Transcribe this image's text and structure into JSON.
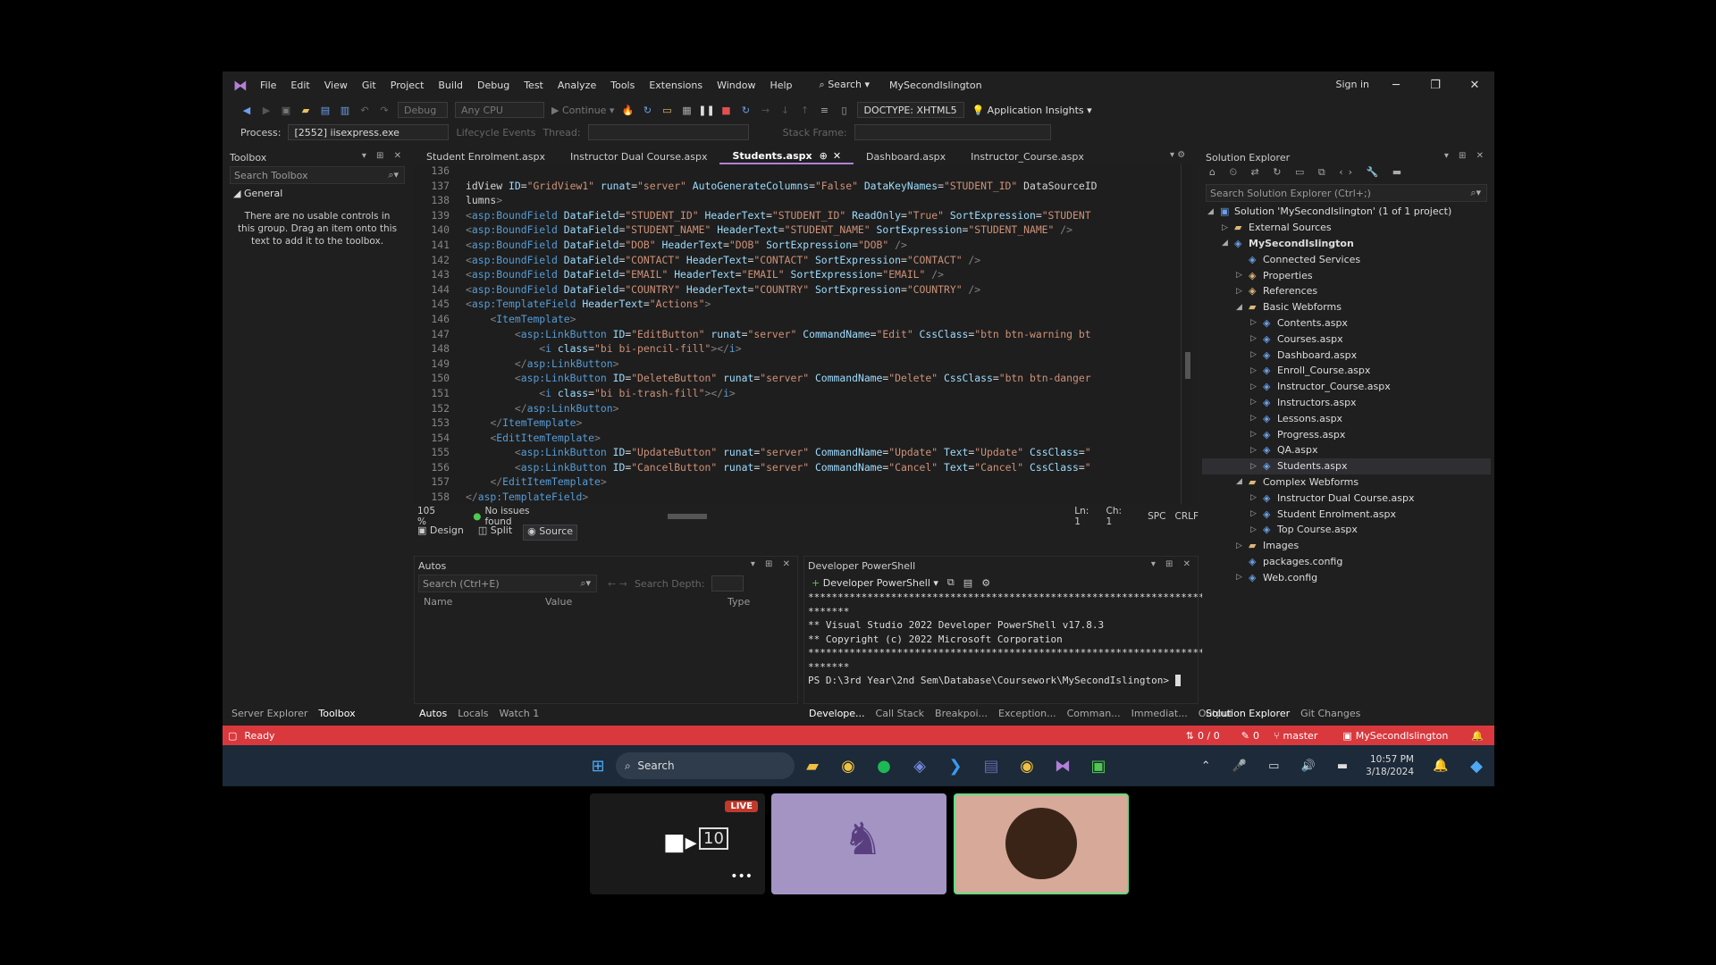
{
  "app": {
    "title": "MySecondIslington",
    "sign_in": "Sign in"
  },
  "menu": [
    "File",
    "Edit",
    "View",
    "Git",
    "Project",
    "Build",
    "Debug",
    "Test",
    "Analyze",
    "Tools",
    "Extensions",
    "Window",
    "Help"
  ],
  "search_label": "Search",
  "toolbar": {
    "config": "Debug",
    "platform": "Any CPU",
    "continue": "Continue",
    "doctype": "DOCTYPE: XHTML5",
    "app_insights": "Application Insights"
  },
  "toolbar2": {
    "process_label": "Process:",
    "process_value": "[2552] iisexpress.exe",
    "lifecycle": "Lifecycle Events",
    "thread": "Thread:",
    "stack": "Stack Frame:"
  },
  "toolbox": {
    "title": "Toolbox",
    "search": "Search Toolbox",
    "group": "General",
    "empty_msg": "There are no usable controls in this group. Drag an item onto this text to add it to the toolbox."
  },
  "tabs": [
    "Student Enrolment.aspx",
    "Instructor Dual Course.aspx",
    "Students.aspx",
    "Dashboard.aspx",
    "Instructor_Course.aspx"
  ],
  "code_lines": [
    {
      "n": "136",
      "c": ""
    },
    {
      "n": "137",
      "c": "idView ID=\"GridView1\" runat=\"server\" AutoGenerateColumns=\"False\" DataKeyNames=\"STUDENT_ID\" DataSourceID"
    },
    {
      "n": "138",
      "c": "lumns>"
    },
    {
      "n": "139",
      "c": "<asp:BoundField DataField=\"STUDENT_ID\" HeaderText=\"STUDENT_ID\" ReadOnly=\"True\" SortExpression=\"STUDENT"
    },
    {
      "n": "140",
      "c": "<asp:BoundField DataField=\"STUDENT_NAME\" HeaderText=\"STUDENT_NAME\" SortExpression=\"STUDENT_NAME\" />"
    },
    {
      "n": "141",
      "c": "<asp:BoundField DataField=\"DOB\" HeaderText=\"DOB\" SortExpression=\"DOB\" />"
    },
    {
      "n": "142",
      "c": "<asp:BoundField DataField=\"CONTACT\" HeaderText=\"CONTACT\" SortExpression=\"CONTACT\" />"
    },
    {
      "n": "143",
      "c": "<asp:BoundField DataField=\"EMAIL\" HeaderText=\"EMAIL\" SortExpression=\"EMAIL\" />"
    },
    {
      "n": "144",
      "c": "<asp:BoundField DataField=\"COUNTRY\" HeaderText=\"COUNTRY\" SortExpression=\"COUNTRY\" />"
    },
    {
      "n": "145",
      "c": "<asp:TemplateField HeaderText=\"Actions\">"
    },
    {
      "n": "146",
      "c": "    <ItemTemplate>"
    },
    {
      "n": "147",
      "c": "        <asp:LinkButton ID=\"EditButton\" runat=\"server\" CommandName=\"Edit\" CssClass=\"btn btn-warning bt"
    },
    {
      "n": "148",
      "c": "            <i class=\"bi bi-pencil-fill\"></i>"
    },
    {
      "n": "149",
      "c": "        </asp:LinkButton>"
    },
    {
      "n": "150",
      "c": "        <asp:LinkButton ID=\"DeleteButton\" runat=\"server\" CommandName=\"Delete\" CssClass=\"btn btn-danger"
    },
    {
      "n": "151",
      "c": "            <i class=\"bi bi-trash-fill\"></i>"
    },
    {
      "n": "152",
      "c": "        </asp:LinkButton>"
    },
    {
      "n": "153",
      "c": "    </ItemTemplate>"
    },
    {
      "n": "154",
      "c": "    <EditItemTemplate>"
    },
    {
      "n": "155",
      "c": "        <asp:LinkButton ID=\"UpdateButton\" runat=\"server\" CommandName=\"Update\" Text=\"Update\" CssClass=\""
    },
    {
      "n": "156",
      "c": "        <asp:LinkButton ID=\"CancelButton\" runat=\"server\" CommandName=\"Cancel\" Text=\"Cancel\" CssClass=\""
    },
    {
      "n": "157",
      "c": "    </EditItemTemplate>"
    },
    {
      "n": "158",
      "c": "</asp:TemplateField>"
    }
  ],
  "editor_status": {
    "zoom": "105 %",
    "issues": "No issues found",
    "ln": "Ln: 1",
    "ch": "Ch: 1",
    "spc": "SPC",
    "crlf": "CRLF"
  },
  "view_buttons": [
    "Design",
    "Split",
    "Source"
  ],
  "autos": {
    "title": "Autos",
    "search": "Search (Ctrl+E)",
    "depth": "Search Depth:",
    "cols": [
      "Name",
      "Value",
      "Type"
    ]
  },
  "powershell": {
    "title": "Developer PowerShell",
    "dropdown": "Developer PowerShell",
    "lines": [
      "**********************************************************************",
      "*******",
      "** Visual Studio 2022 Developer PowerShell v17.8.3",
      "** Copyright (c) 2022 Microsoft Corporation",
      "**********************************************************************",
      "*******",
      "PS D:\\3rd Year\\2nd Sem\\Database\\Coursework\\MySecondIslington> "
    ]
  },
  "solution": {
    "title": "Solution Explorer",
    "search": "Search Solution Explorer (Ctrl+;)",
    "rows": [
      {
        "d": 0,
        "label": "Solution 'MySecondIslington' (1 of 1 project)",
        "bold": false
      },
      {
        "d": 1,
        "label": "External Sources",
        "bold": false
      },
      {
        "d": 1,
        "label": "MySecondIslington",
        "bold": true
      },
      {
        "d": 2,
        "label": "Connected Services",
        "bold": false
      },
      {
        "d": 2,
        "label": "Properties",
        "bold": false
      },
      {
        "d": 2,
        "label": "References",
        "bold": false
      },
      {
        "d": 2,
        "label": "Basic Webforms",
        "bold": false
      },
      {
        "d": 3,
        "label": "Contents.aspx",
        "bold": false
      },
      {
        "d": 3,
        "label": "Courses.aspx",
        "bold": false
      },
      {
        "d": 3,
        "label": "Dashboard.aspx",
        "bold": false
      },
      {
        "d": 3,
        "label": "Enroll_Course.aspx",
        "bold": false
      },
      {
        "d": 3,
        "label": "Instructor_Course.aspx",
        "bold": false
      },
      {
        "d": 3,
        "label": "Instructors.aspx",
        "bold": false
      },
      {
        "d": 3,
        "label": "Lessons.aspx",
        "bold": false
      },
      {
        "d": 3,
        "label": "Progress.aspx",
        "bold": false
      },
      {
        "d": 3,
        "label": "QA.aspx",
        "bold": false
      },
      {
        "d": 3,
        "label": "Students.aspx",
        "bold": false
      },
      {
        "d": 2,
        "label": "Complex Webforms",
        "bold": false
      },
      {
        "d": 3,
        "label": "Instructor Dual Course.aspx",
        "bold": false
      },
      {
        "d": 3,
        "label": "Student Enrolment.aspx",
        "bold": false
      },
      {
        "d": 3,
        "label": "Top Course.aspx",
        "bold": false
      },
      {
        "d": 2,
        "label": "Images",
        "bold": false
      },
      {
        "d": 2,
        "label": "packages.config",
        "bold": false
      },
      {
        "d": 2,
        "label": "Web.config",
        "bold": false
      }
    ]
  },
  "bottom_tabs_left": [
    "Server Explorer",
    "Toolbox"
  ],
  "bottom_tabs_mid": [
    "Autos",
    "Locals",
    "Watch 1"
  ],
  "bottom_tabs_ps": [
    "Develope...",
    "Call Stack",
    "Breakpoi...",
    "Exception...",
    "Comman...",
    "Immediat...",
    "Output"
  ],
  "bottom_tabs_right": [
    "Solution Explorer",
    "Git Changes"
  ],
  "statusbar": {
    "ready": "Ready",
    "arrows": "0 / 0",
    "edits": "0",
    "branch": "master",
    "repo": "MySecondIslington"
  },
  "taskbar": {
    "search": "Search",
    "time": "10:57 PM",
    "date": "3/18/2024"
  },
  "thumbs": {
    "live": "LIVE",
    "count": "10"
  },
  "colors": {
    "accent": "#b180d7",
    "status": "#d9383d",
    "taskbar": "#1c2a3a"
  }
}
